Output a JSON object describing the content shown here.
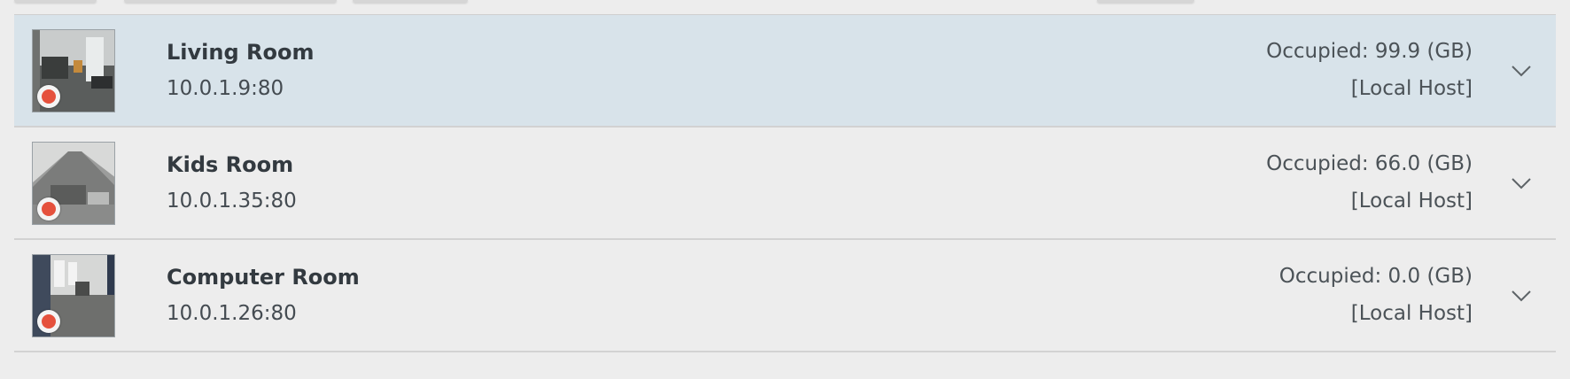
{
  "cameras": [
    {
      "name": "Living Room",
      "address": "10.0.1.9:80",
      "occupied": "Occupied: 99.9 (GB)",
      "host": "[Local Host]",
      "selected": true,
      "recording": true
    },
    {
      "name": "Kids Room",
      "address": "10.0.1.35:80",
      "occupied": "Occupied: 66.0 (GB)",
      "host": "[Local Host]",
      "selected": false,
      "recording": true
    },
    {
      "name": "Computer Room",
      "address": "10.0.1.26:80",
      "occupied": "Occupied: 0.0 (GB)",
      "host": "[Local Host]",
      "selected": false,
      "recording": true
    }
  ],
  "icons": {
    "record": "record-icon",
    "expand": "chevron-down-icon"
  },
  "colors": {
    "selected_row": "#d8e3ea",
    "record_dot": "#e5513d"
  }
}
